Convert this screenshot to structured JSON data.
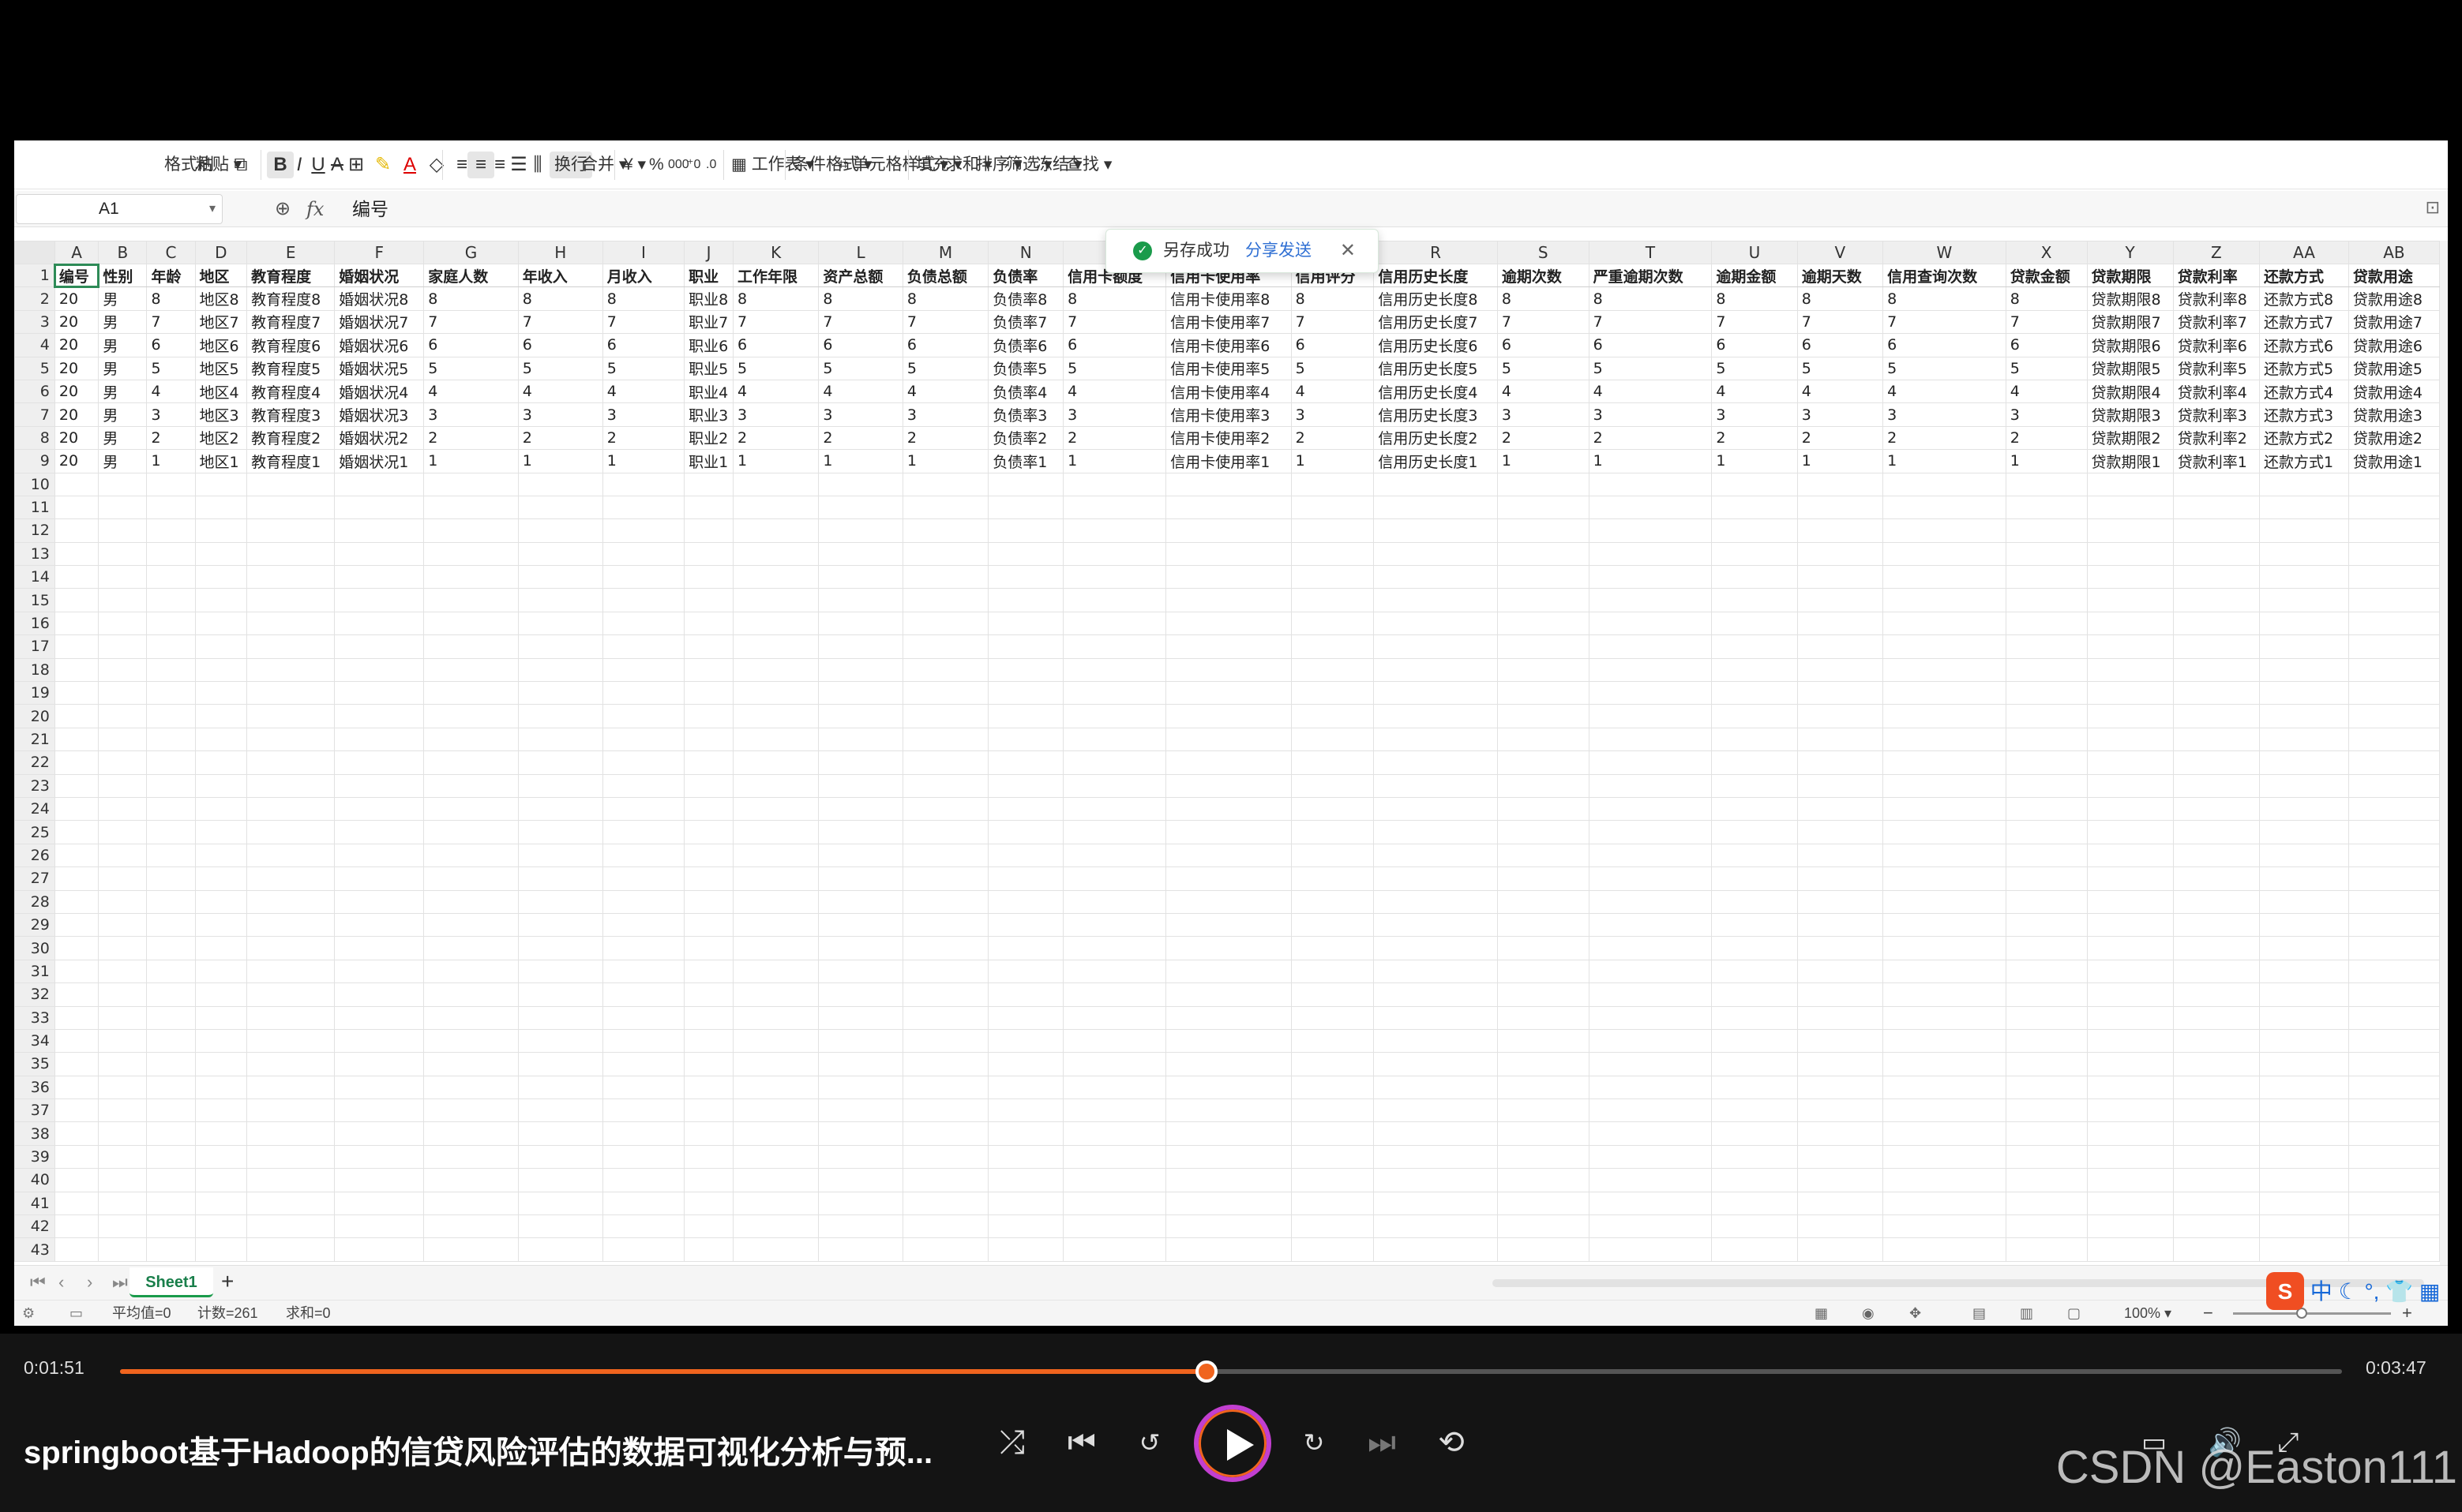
{
  "toolbar": {
    "format_painter": "格式刷",
    "paste": "粘贴",
    "bold": "B",
    "italic": "I",
    "underline": "U",
    "wrap": "换行",
    "merge": "合并",
    "currency": "¥",
    "percent": "%",
    "worksheet": "工作表",
    "cond_format": "条件格式",
    "cell_style": "单元格样式",
    "fill": "填充",
    "sum": "求和",
    "sort": "排序",
    "filter": "筛选",
    "freeze": "冻结",
    "find": "查找"
  },
  "formula_bar": {
    "name_box": "A1",
    "fx": "fx",
    "content": "编号"
  },
  "toast": {
    "message": "另存成功",
    "action": "分享发送"
  },
  "columns": [
    "A",
    "B",
    "C",
    "D",
    "E",
    "F",
    "G",
    "H",
    "I",
    "J",
    "K",
    "L",
    "M",
    "N",
    "O",
    "P",
    "Q",
    "R",
    "S",
    "T",
    "U",
    "V",
    "W",
    "X",
    "Y",
    "Z",
    "AA",
    "AB"
  ],
  "headers": [
    "编号",
    "性别",
    "年龄",
    "地区",
    "教育程度",
    "婚姻状况",
    "家庭人数",
    "年收入",
    "月收入",
    "职业",
    "工作年限",
    "资产总额",
    "负债总额",
    "负债率",
    "信用卡额度",
    "信用卡使用率",
    "信用评分",
    "信用历史长度",
    "逾期次数",
    "严重逾期次数",
    "逾期金额",
    "逾期天数",
    "信用查询次数",
    "贷款金额",
    "贷款期限",
    "贷款利率",
    "还款方式",
    "贷款用途"
  ],
  "rows": [
    [
      "20",
      "男",
      "8",
      "地区8",
      "教育程度8",
      "婚姻状况8",
      "8",
      "8",
      "8",
      "职业8",
      "8",
      "8",
      "8",
      "负债率8",
      "8",
      "信用卡使用率8",
      "8",
      "信用历史长度8",
      "8",
      "8",
      "8",
      "8",
      "8",
      "8",
      "贷款期限8",
      "贷款利率8",
      "还款方式8",
      "贷款用途8"
    ],
    [
      "20",
      "男",
      "7",
      "地区7",
      "教育程度7",
      "婚姻状况7",
      "7",
      "7",
      "7",
      "职业7",
      "7",
      "7",
      "7",
      "负债率7",
      "7",
      "信用卡使用率7",
      "7",
      "信用历史长度7",
      "7",
      "7",
      "7",
      "7",
      "7",
      "7",
      "贷款期限7",
      "贷款利率7",
      "还款方式7",
      "贷款用途7"
    ],
    [
      "20",
      "男",
      "6",
      "地区6",
      "教育程度6",
      "婚姻状况6",
      "6",
      "6",
      "6",
      "职业6",
      "6",
      "6",
      "6",
      "负债率6",
      "6",
      "信用卡使用率6",
      "6",
      "信用历史长度6",
      "6",
      "6",
      "6",
      "6",
      "6",
      "6",
      "贷款期限6",
      "贷款利率6",
      "还款方式6",
      "贷款用途6"
    ],
    [
      "20",
      "男",
      "5",
      "地区5",
      "教育程度5",
      "婚姻状况5",
      "5",
      "5",
      "5",
      "职业5",
      "5",
      "5",
      "5",
      "负债率5",
      "5",
      "信用卡使用率5",
      "5",
      "信用历史长度5",
      "5",
      "5",
      "5",
      "5",
      "5",
      "5",
      "贷款期限5",
      "贷款利率5",
      "还款方式5",
      "贷款用途5"
    ],
    [
      "20",
      "男",
      "4",
      "地区4",
      "教育程度4",
      "婚姻状况4",
      "4",
      "4",
      "4",
      "职业4",
      "4",
      "4",
      "4",
      "负债率4",
      "4",
      "信用卡使用率4",
      "4",
      "信用历史长度4",
      "4",
      "4",
      "4",
      "4",
      "4",
      "4",
      "贷款期限4",
      "贷款利率4",
      "还款方式4",
      "贷款用途4"
    ],
    [
      "20",
      "男",
      "3",
      "地区3",
      "教育程度3",
      "婚姻状况3",
      "3",
      "3",
      "3",
      "职业3",
      "3",
      "3",
      "3",
      "负债率3",
      "3",
      "信用卡使用率3",
      "3",
      "信用历史长度3",
      "3",
      "3",
      "3",
      "3",
      "3",
      "3",
      "贷款期限3",
      "贷款利率3",
      "还款方式3",
      "贷款用途3"
    ],
    [
      "20",
      "男",
      "2",
      "地区2",
      "教育程度2",
      "婚姻状况2",
      "2",
      "2",
      "2",
      "职业2",
      "2",
      "2",
      "2",
      "负债率2",
      "2",
      "信用卡使用率2",
      "2",
      "信用历史长度2",
      "2",
      "2",
      "2",
      "2",
      "2",
      "2",
      "贷款期限2",
      "贷款利率2",
      "还款方式2",
      "贷款用途2"
    ],
    [
      "20",
      "男",
      "1",
      "地区1",
      "教育程度1",
      "婚姻状况1",
      "1",
      "1",
      "1",
      "职业1",
      "1",
      "1",
      "1",
      "负债率1",
      "1",
      "信用卡使用率1",
      "1",
      "信用历史长度1",
      "1",
      "1",
      "1",
      "1",
      "1",
      "1",
      "贷款期限1",
      "贷款利率1",
      "还款方式1",
      "贷款用途1"
    ]
  ],
  "visible_row_count": 43,
  "sheet_tab": "Sheet1",
  "status": {
    "average": "平均值=0",
    "count": "计数=261",
    "sum": "求和=0",
    "zoom": "100%"
  },
  "ime": {
    "label": "中"
  },
  "player": {
    "current_time": "0:01:51",
    "total_time": "0:03:47",
    "progress": 0.489,
    "title": "springboot基于Hadoop的信贷风险评估的数据可视化分析与预...",
    "watermark": "CSDN @Easton111"
  },
  "icons": [
    "copy-icon",
    "strikethrough-icon",
    "border-icon",
    "highlight-icon",
    "font-color-icon",
    "eraser-icon",
    "align-left-icon",
    "align-center-icon",
    "align-right-icon",
    "justify-icon",
    "distribute-icon",
    "zoom-icon",
    "check-icon",
    "close-icon",
    "shuffle-icon",
    "previous-icon",
    "rewind-icon",
    "play-icon",
    "forward-icon",
    "next-icon",
    "loop-icon",
    "subtitle-icon",
    "volume-icon",
    "fullscreen-icon"
  ]
}
